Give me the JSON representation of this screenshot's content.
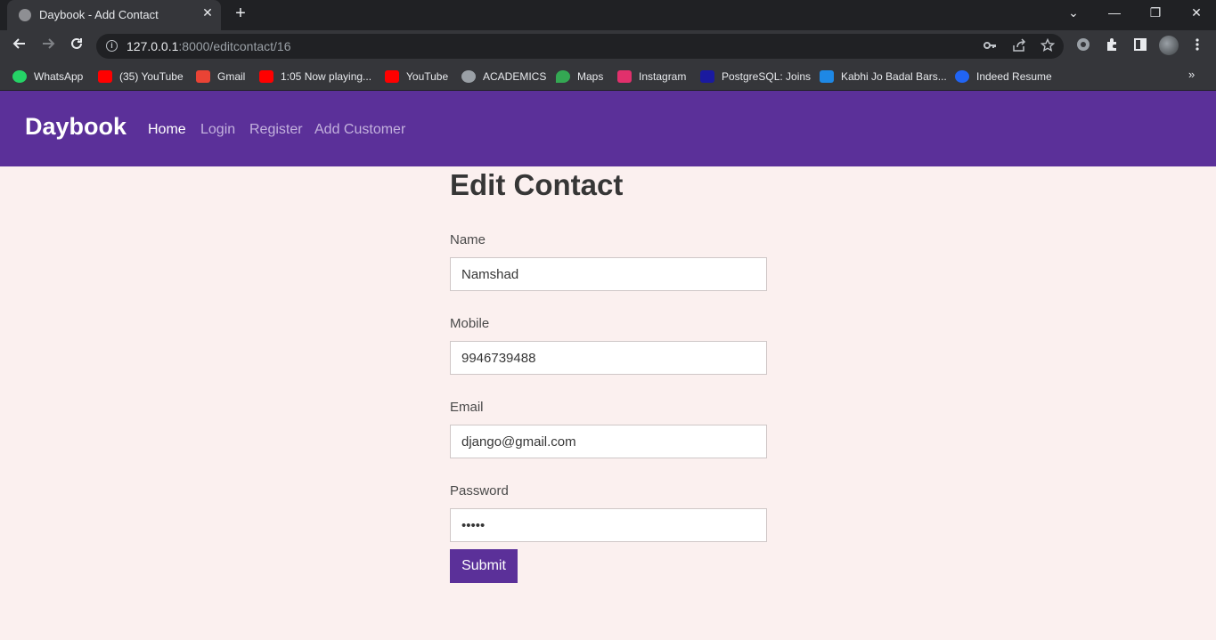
{
  "browser": {
    "tab_title": "Daybook - Add Contact",
    "tab_close": "✕",
    "new_tab": "+",
    "url_host": "127.0.0.1",
    "url_path": ":8000/editcontact/16",
    "window_controls": {
      "dropdown": "⌄",
      "minimize": "—",
      "restore": "❐",
      "close": "✕"
    },
    "toolbar_icons": [
      "key-icon",
      "share-icon",
      "star-icon",
      "extension-circle-icon",
      "puzzle-icon",
      "side-panel-icon",
      "profile-avatar",
      "menu-dots-icon"
    ],
    "bookmarks": [
      {
        "label": "WhatsApp",
        "icon": "whatsapp-icon",
        "color": "#25d366"
      },
      {
        "label": "(35) YouTube",
        "icon": "youtube-icon",
        "color": "#ff0000"
      },
      {
        "label": "Gmail",
        "icon": "gmail-icon",
        "color": "#ea4335"
      },
      {
        "label": "1:05 Now playing...",
        "icon": "youtube-icon",
        "color": "#ff0000"
      },
      {
        "label": "YouTube",
        "icon": "youtube-icon",
        "color": "#ff0000"
      },
      {
        "label": "ACADEMICS",
        "icon": "globe-icon",
        "color": "#9aa0a6"
      },
      {
        "label": "Maps",
        "icon": "maps-icon",
        "color": "#34a853"
      },
      {
        "label": "Instagram",
        "icon": "instagram-icon",
        "color": "#e1306c"
      },
      {
        "label": "PostgreSQL: Joins",
        "icon": "postgresql-icon",
        "color": "#1a1aa0"
      },
      {
        "label": "Kabhi Jo Badal Bars...",
        "icon": "music-icon",
        "color": "#1e88e5"
      },
      {
        "label": "Indeed Resume",
        "icon": "indeed-icon",
        "color": "#2164f3"
      }
    ],
    "bookmarks_more": "»"
  },
  "navbar": {
    "brand": "Daybook",
    "links": [
      {
        "label": "Home",
        "active": true
      },
      {
        "label": "Login",
        "active": false
      },
      {
        "label": "Register",
        "active": false
      },
      {
        "label": "Add Customer",
        "active": false
      }
    ]
  },
  "form": {
    "title": "Edit Contact",
    "fields": {
      "name": {
        "label": "Name",
        "value": "Namshad"
      },
      "mobile": {
        "label": "Mobile",
        "value": "9946739488"
      },
      "email": {
        "label": "Email",
        "value": "django@gmail.com"
      },
      "password": {
        "label": "Password",
        "value": "•••••"
      }
    },
    "submit_label": "Submit"
  },
  "colors": {
    "accent": "#5b3099",
    "page_background": "#fbf0ef",
    "nav_link_active": "#ffffff",
    "nav_link_inactive": "#c3b1dd"
  }
}
